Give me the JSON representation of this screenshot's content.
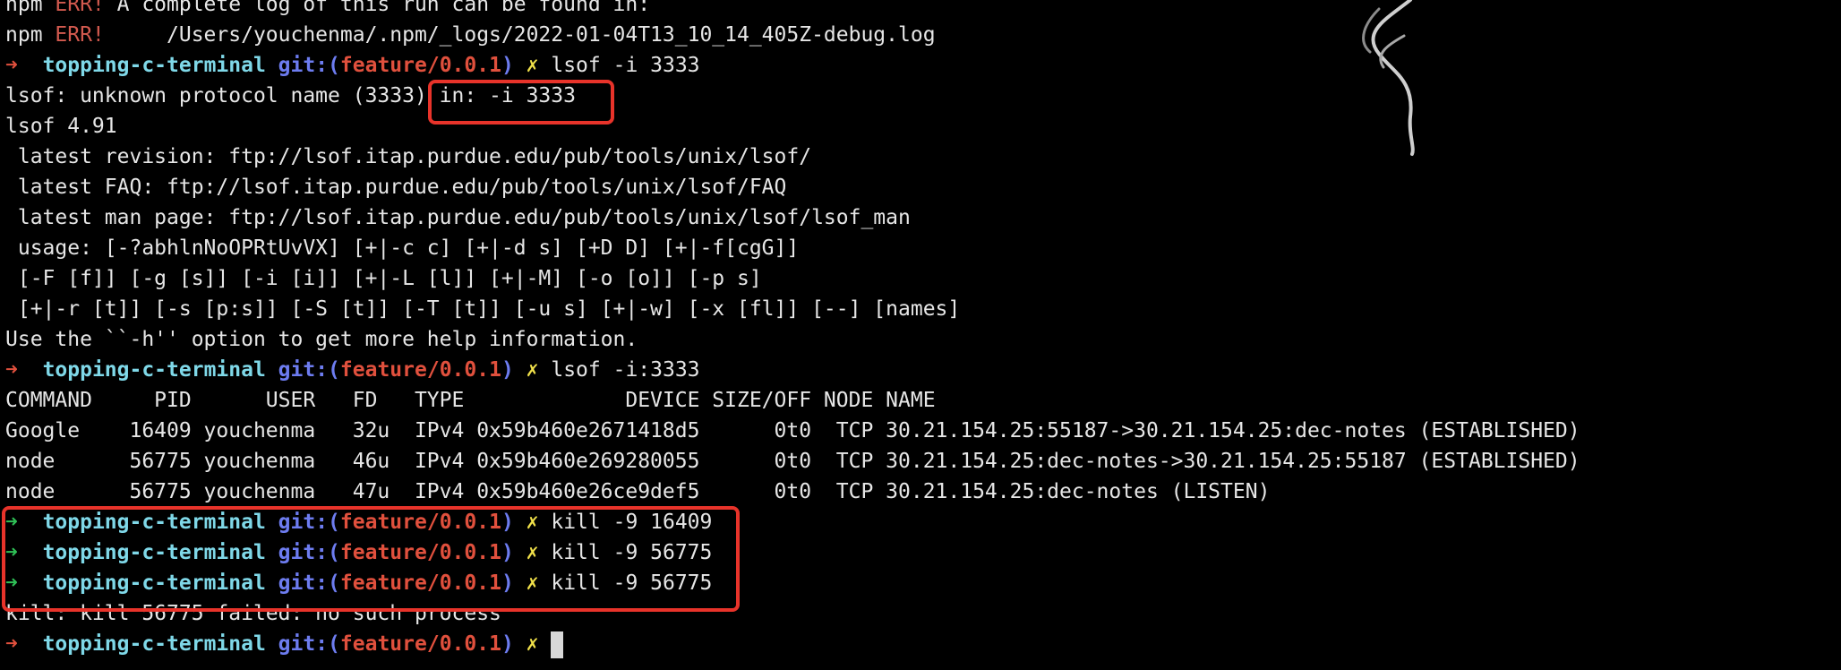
{
  "terminal": {
    "prompt": {
      "dir": "topping-c-terminal",
      "git_prefix": "git:(",
      "branch": "feature/0.0.1",
      "git_suffix": ")",
      "dirty": "✗",
      "arrow": "➜",
      "arrow_compact": "➜"
    },
    "lines": {
      "npm_err_1": {
        "tag": "npm ",
        "err": "ERR!",
        "text": " A complete log of this run can be found in:"
      },
      "npm_err_2": {
        "tag": "npm ",
        "err": "ERR!",
        "text": "     /Users/youchenma/.npm/_logs/2022-01-04T13_10_14_405Z-debug.log"
      },
      "cmd_1": " lsof -i 3333",
      "lsof_error": "lsof: unknown protocol name (3333) in: -i 3333",
      "lsof_version": "lsof 4.91",
      "latest_revision": " latest revision: ftp://lsof.itap.purdue.edu/pub/tools/unix/lsof/",
      "latest_faq": " latest FAQ: ftp://lsof.itap.purdue.edu/pub/tools/unix/lsof/FAQ",
      "latest_man": " latest man page: ftp://lsof.itap.purdue.edu/pub/tools/unix/lsof/lsof_man",
      "usage_1": " usage: [-?abhlnNoOPRtUvVX] [+|-c c] [+|-d s] [+D D] [+|-f[cgG]]",
      "usage_2": " [-F [f]] [-g [s]] [-i [i]] [+|-L [l]] [+|-M] [-o [o]] [-p s]",
      "usage_3": " [+|-r [t]] [-s [p:s]] [-S [t]] [-T [t]] [-u s] [+|-w] [-x [fl]] [--] [names]",
      "help_hint": "Use the ``-h'' option to get more help information.",
      "cmd_2": " lsof -i:3333",
      "table_header": "COMMAND     PID      USER   FD   TYPE             DEVICE SIZE/OFF NODE NAME",
      "row_1": "Google    16409 youchenma   32u  IPv4 0x59b460e2671418d5      0t0  TCP 30.21.154.25:55187->30.21.154.25:dec-notes (ESTABLISHED)",
      "row_2": "node      56775 youchenma   46u  IPv4 0x59b460e269280055      0t0  TCP 30.21.154.25:dec-notes->30.21.154.25:55187 (ESTABLISHED)",
      "row_3": "node      56775 youchenma   47u  IPv4 0x59b460e26ce9def5      0t0  TCP 30.21.154.25:dec-notes (LISTEN)",
      "cmd_3": " kill -9 16409",
      "cmd_4": " kill -9 56775",
      "cmd_5": " kill -9 56775",
      "kill_error": "kill: kill 56775 failed: no such process"
    }
  },
  "colors": {
    "background": "#000000",
    "npm_err": "#d35a4f",
    "prompt_arrow": "#e0503d",
    "prompt_arrow_success": "#2fbf56",
    "directory": "#7fd8e8",
    "git_label": "#6d7cf0",
    "branch": "#e0503d",
    "dirty_mark": "#f0e04a",
    "highlight_box": "#e8332a"
  }
}
